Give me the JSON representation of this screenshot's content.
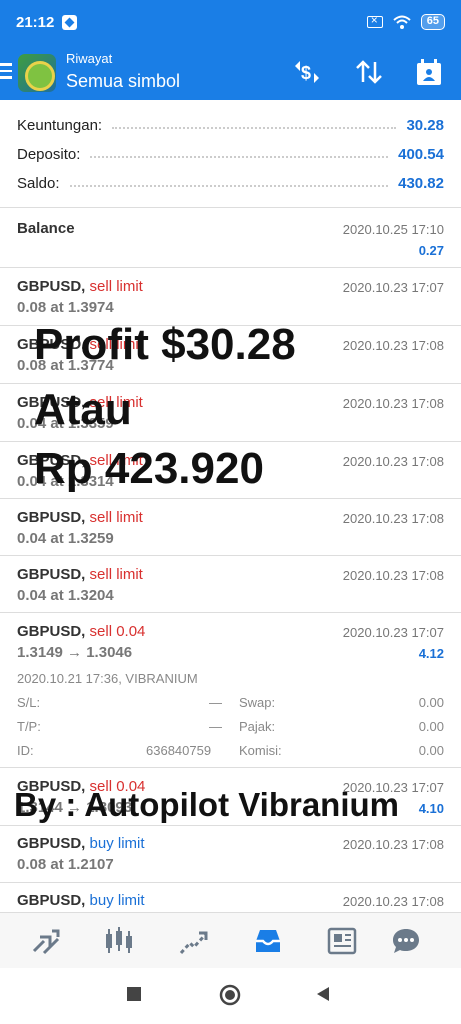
{
  "status": {
    "time": "21:12",
    "battery": "65"
  },
  "appbar": {
    "subtitle": "Riwayat",
    "title": "Semua simbol"
  },
  "summary": [
    {
      "label": "Keuntungan:",
      "value": "30.28"
    },
    {
      "label": "Deposito:",
      "value": "400.54"
    },
    {
      "label": "Saldo:",
      "value": "430.82"
    }
  ],
  "balance": {
    "title": "Balance",
    "date": "2020.10.25 17:10",
    "amount": "0.27"
  },
  "orders": [
    {
      "symbol": "GBPUSD,",
      "type": "sell limit",
      "sub": "0.08 at 1.3974",
      "date": "2020.10.23 17:07"
    },
    {
      "symbol": "GBPUSD,",
      "type": "sell limit",
      "sub": "0.08 at 1.3774",
      "date": "2020.10.23 17:08"
    },
    {
      "symbol": "GBPUSD,",
      "type": "sell limit",
      "sub": "0.04 at 1.3359",
      "date": "2020.10.23 17:08"
    },
    {
      "symbol": "GBPUSD,",
      "type": "sell limit",
      "sub": "0.04 at 1.3314",
      "date": "2020.10.23 17:08"
    },
    {
      "symbol": "GBPUSD,",
      "type": "sell limit",
      "sub": "0.04 at 1.3259",
      "date": "2020.10.23 17:08"
    },
    {
      "symbol": "GBPUSD,",
      "type": "sell limit",
      "sub": "0.04 at 1.3204",
      "date": "2020.10.23 17:08"
    }
  ],
  "deal": {
    "symbol": "GBPUSD,",
    "type": "sell 0.04",
    "sub": "1.3149 → 1.3046",
    "date": "2020.10.23 17:07",
    "amount": "4.12",
    "open": "2020.10.21 17:36, VIBRANIUM",
    "sl_label": "S/L:",
    "sl_value": "—",
    "swap_label": "Swap:",
    "swap_value": "0.00",
    "tp_label": "T/P:",
    "tp_value": "—",
    "tax_label": "Pajak:",
    "tax_value": "0.00",
    "id_label": "ID:",
    "id_value": "636840759",
    "comm_label": "Komisi:",
    "comm_value": "0.00"
  },
  "deal2": {
    "symbol": "GBPUSD,",
    "type": "sell 0.04",
    "sub": "1.3144 → 1.3093",
    "date": "2020.10.23 17:07",
    "amount": "4.10"
  },
  "buy_orders": [
    {
      "symbol": "GBPUSD,",
      "type": "buy limit",
      "sub": "0.08 at 1.2107",
      "date": "2020.10.23 17:08"
    },
    {
      "symbol": "GBPUSD,",
      "type": "buy limit",
      "sub": "",
      "date": "2020.10.23 17:08"
    }
  ],
  "overlay": {
    "line1": "Profit $30.28",
    "line2": "Atau",
    "line3": "Rp 423.920",
    "byline": "By : Autopilot Vibranium"
  },
  "colors": {
    "primary": "#1a7ee6",
    "sell": "#d8302f",
    "buy": "#1a70d6"
  }
}
